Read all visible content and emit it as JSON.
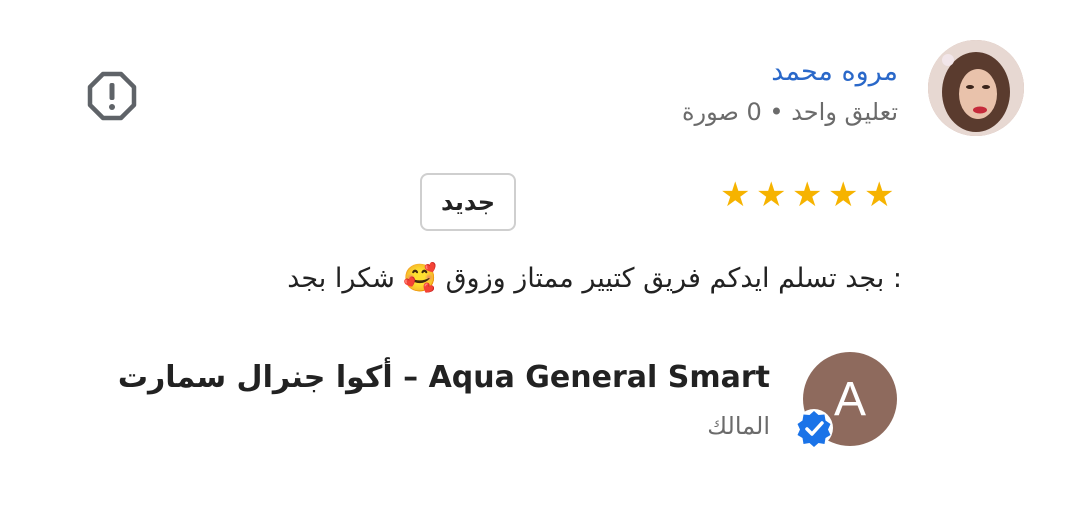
{
  "review": {
    "reviewer_name": "مروه محمد",
    "reviewer_meta": "تعليق واحد • 0 صورة",
    "rating": 5,
    "badge": "جديد",
    "text": ": بجد تسلم ايدكم فريق كتيير ممتاز وزوق 🥰 شكرا بجد"
  },
  "owner_reply": {
    "avatar_letter": "A",
    "name": "Aqua General Smart – أكوا جنرال سمارت",
    "role": "المالك"
  },
  "icons": {
    "report": "report-flag-octagon-icon",
    "star": "star-icon",
    "verified": "verified-badge-icon"
  },
  "colors": {
    "name_link": "#2a68c9",
    "star": "#f6b300",
    "verified": "#1a73e8"
  }
}
